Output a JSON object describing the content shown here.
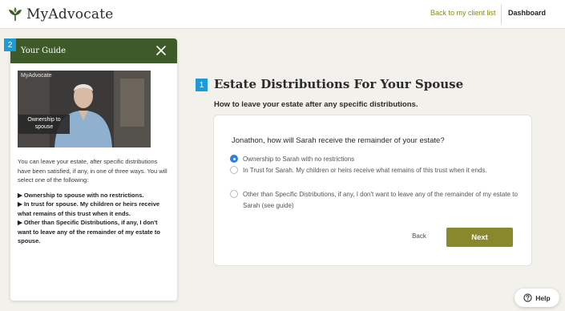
{
  "header": {
    "logo_text": "MyAdvocate",
    "back_link": "Back to my client list",
    "dashboard_link": "Dashboard"
  },
  "guide": {
    "step": "2",
    "title": "Your Guide",
    "video": {
      "watermark": "MyAdvocate",
      "caption": "Ownership to spouse"
    },
    "intro": "You can leave your estate, after specific distributions have been satisfied, if any, in one of three ways. You will select one of the following:",
    "items": [
      "▶ Ownership to spouse with no restrictions.",
      "▶ In trust for spouse. My children or heirs receive what remains of this trust when it ends.",
      "▶ Other than Specific Distributions, if any, I don't want to leave any of the remainder of my estate to spouse."
    ]
  },
  "main": {
    "step": "1",
    "title": "Estate Distributions For Your Spouse",
    "subtitle": "How to leave your estate after any specific distributions.",
    "question": "Jonathon, how will Sarah receive the remainder of your estate?",
    "options": [
      {
        "label": "Ownership to Sarah with no restrictions",
        "selected": true
      },
      {
        "label": "In Trust for Sarah. My children or heirs receive what remains of this trust when it ends.",
        "selected": false
      },
      {
        "label": "Other than Specific Distributions, if any, I don't want to leave any of the remainder of my estate to Sarah (see guide)",
        "selected": false
      }
    ],
    "back_label": "Back",
    "next_label": "Next"
  },
  "help": {
    "label": "Help"
  },
  "colors": {
    "brand_green": "#3d5a28",
    "accent_olive": "#88882c",
    "link_olive": "#8a8a1f",
    "step_blue": "#1d9bd8",
    "radio_blue": "#2f7de0",
    "background": "#f3f1ec"
  },
  "icons": {
    "logo": "leaf-logo-icon",
    "close": "close-icon",
    "help": "question-circle-icon",
    "radio_selected": "radio-selected-icon"
  }
}
